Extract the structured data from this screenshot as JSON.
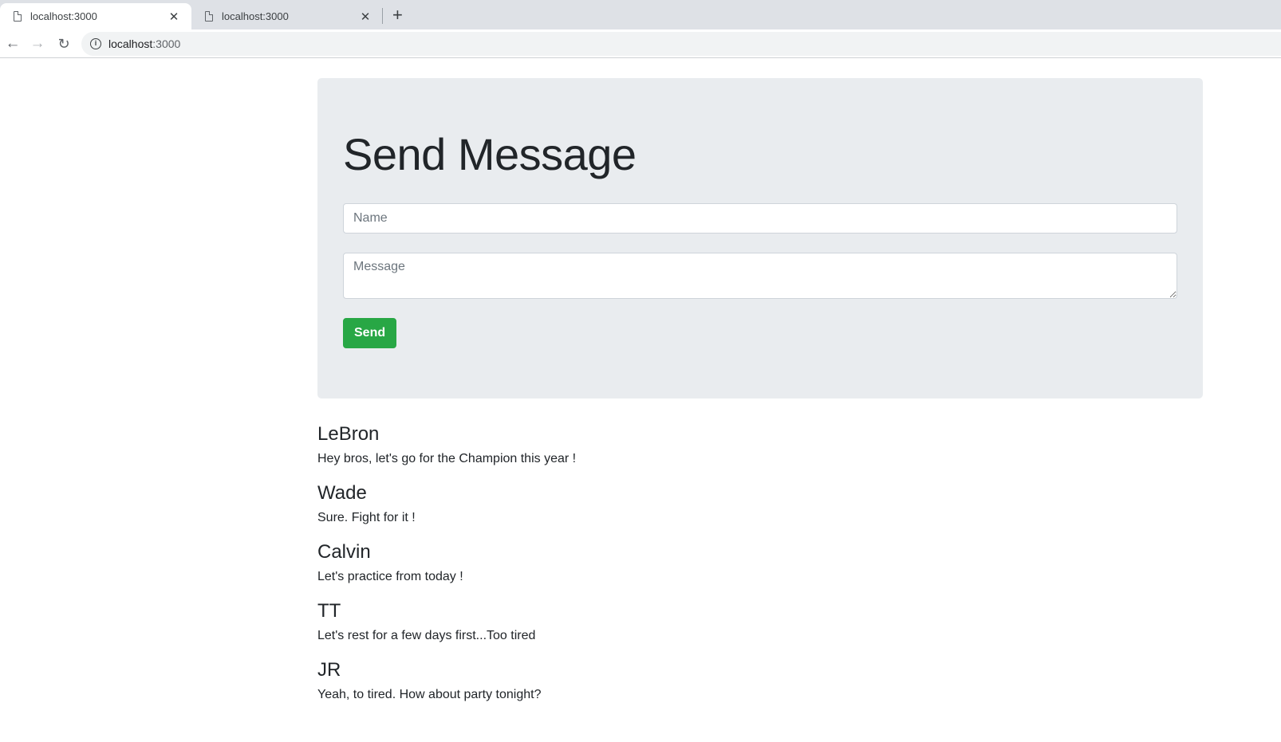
{
  "browser": {
    "tabs": [
      {
        "title": "localhost:3000"
      },
      {
        "title": "localhost:3000"
      }
    ],
    "new_tab_symbol": "+",
    "close_symbol": "✕",
    "url_host": "localhost",
    "url_port": ":3000"
  },
  "form": {
    "title": "Send Message",
    "name_placeholder": "Name",
    "message_placeholder": "Message",
    "send_label": "Send"
  },
  "messages": [
    {
      "name": "LeBron",
      "text": "Hey bros, let's go for the Champion this year !"
    },
    {
      "name": "Wade",
      "text": "Sure. Fight for it !"
    },
    {
      "name": "Calvin",
      "text": "Let's practice from today !"
    },
    {
      "name": "TT",
      "text": "Let's rest for a few days first...Too tired"
    },
    {
      "name": "JR",
      "text": "Yeah, to tired. How about party tonight?"
    }
  ],
  "colors": {
    "jumbotron_bg": "#e9ecef",
    "send_button": "#28a745",
    "text": "#212529"
  }
}
